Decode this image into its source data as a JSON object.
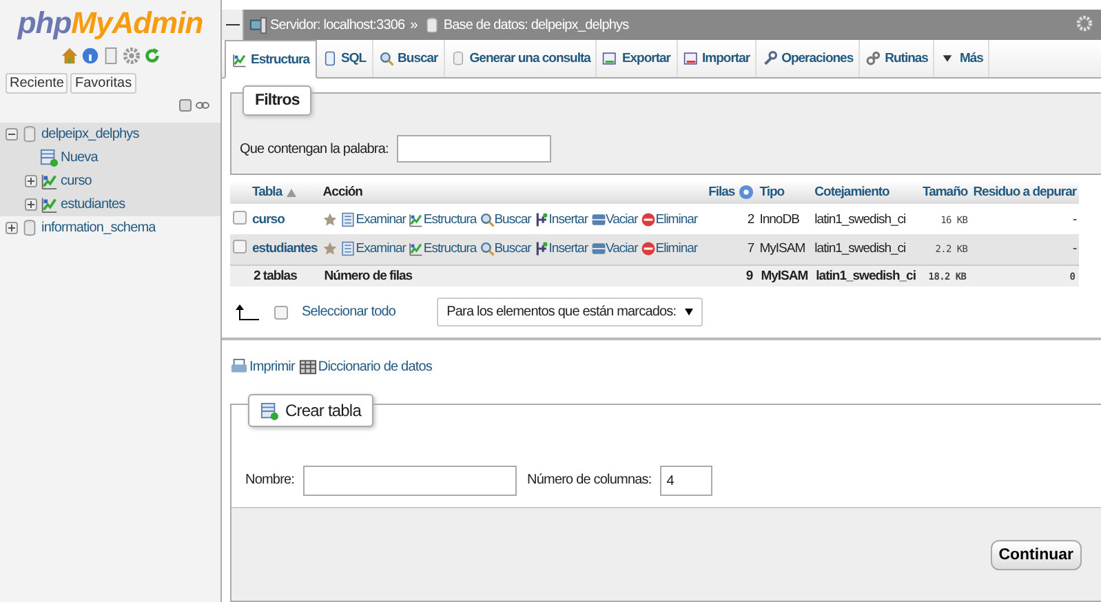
{
  "logo": {
    "prefix": "php",
    "suffix": "MyAdmin"
  },
  "sidebar": {
    "icons": [
      {
        "kind": "home"
      },
      {
        "kind": "info"
      },
      {
        "kind": "doc"
      },
      {
        "kind": "gear"
      },
      {
        "kind": "reload"
      }
    ],
    "buttons": [
      "Reciente",
      "Favoritas"
    ],
    "tree": [
      {
        "label": "delpeipx_delphys",
        "kind": "database",
        "expanded": true,
        "children": [
          {
            "label": "Nueva",
            "kind": "new"
          },
          {
            "label": "curso",
            "kind": "table",
            "expanded": false
          },
          {
            "label": "estudiantes",
            "kind": "table",
            "expanded": false
          }
        ]
      },
      {
        "label": "information_schema",
        "kind": "database",
        "expanded": false
      }
    ]
  },
  "breadcrumb": {
    "separator": "»",
    "items": [
      {
        "kind": "server",
        "label": "Servidor: localhost:3306"
      },
      {
        "kind": "database",
        "label": "Base de datos: delpeipx_delphys"
      }
    ]
  },
  "tabs": [
    {
      "kind": "structure",
      "label": "Estructura",
      "selected": true
    },
    {
      "kind": "sql",
      "label": "SQL",
      "selected": false
    },
    {
      "kind": "search",
      "label": "Buscar",
      "selected": false
    },
    {
      "kind": "query",
      "label": "Generar una consulta",
      "selected": false
    },
    {
      "kind": "export",
      "label": "Exportar",
      "selected": false
    },
    {
      "kind": "import",
      "label": "Importar",
      "selected": false
    },
    {
      "kind": "operations",
      "label": "Operaciones",
      "selected": false
    },
    {
      "kind": "routines",
      "label": "Rutinas",
      "selected": false
    },
    {
      "kind": "more",
      "label": "Más",
      "selected": false
    }
  ],
  "filters": {
    "legend": "Filtros",
    "label": "Que contengan la palabra:"
  },
  "table": {
    "columns": [
      "Tabla",
      "Acción",
      "Filas",
      "Tipo",
      "Cotejamiento",
      "Tamaño",
      "Residuo a depurar"
    ],
    "rows": [
      {
        "checked": false,
        "name": "curso",
        "actions": [
          {
            "kind": "browse",
            "label": "Examinar"
          },
          {
            "kind": "structure",
            "label": "Estructura"
          },
          {
            "kind": "search",
            "label": "Buscar"
          },
          {
            "kind": "insert",
            "label": "Insertar"
          },
          {
            "kind": "empty",
            "label": "Vaciar"
          },
          {
            "kind": "drop",
            "label": "Eliminar"
          }
        ],
        "rows": "2",
        "type": "InnoDB",
        "collation": "latin1_swedish_ci",
        "size": "16",
        "unit": "KB",
        "overhead": "-"
      },
      {
        "checked": false,
        "name": "estudiantes",
        "actions": [
          {
            "kind": "browse",
            "label": "Examinar"
          },
          {
            "kind": "structure",
            "label": "Estructura"
          },
          {
            "kind": "search",
            "label": "Buscar"
          },
          {
            "kind": "insert",
            "label": "Insertar"
          },
          {
            "kind": "empty",
            "label": "Vaciar"
          },
          {
            "kind": "drop",
            "label": "Eliminar"
          }
        ],
        "rows": "7",
        "type": "MyISAM",
        "collation": "latin1_swedish_ci",
        "size": "2.2",
        "unit": "KB",
        "overhead": "-"
      }
    ],
    "totals": {
      "label": "2 tablas",
      "action": "Número de filas",
      "rows": "9",
      "type": "MyISAM",
      "collation": "latin1_swedish_ci",
      "size": "18.2",
      "unit": "KB",
      "overhead": "0"
    }
  },
  "bulk": {
    "checked": false,
    "select_all": "Seleccionar todo",
    "with_selected": "Para los elementos que están marcados:"
  },
  "links": [
    {
      "kind": "print",
      "label": "Imprimir"
    },
    {
      "kind": "dictionary",
      "label": "Diccionario de datos"
    }
  ],
  "create": {
    "legend": "Crear tabla",
    "name_label": "Nombre:",
    "columns_label": "Número de columnas:",
    "columns_value": "4",
    "button": "Continuar"
  }
}
